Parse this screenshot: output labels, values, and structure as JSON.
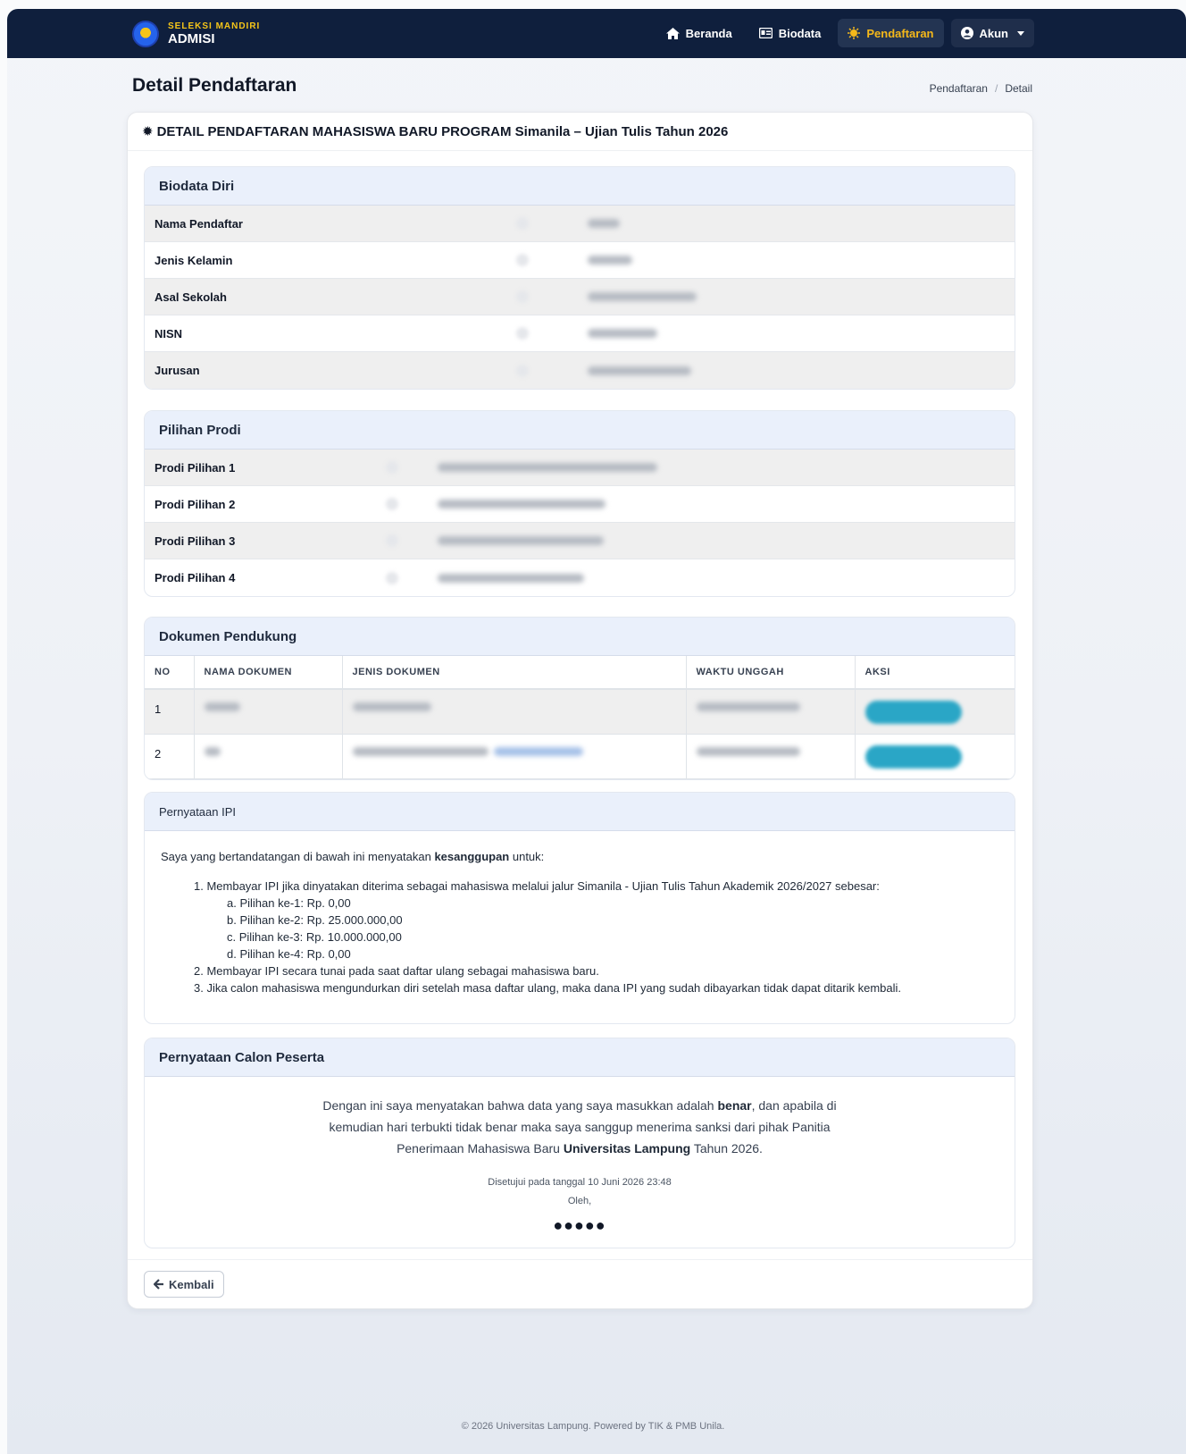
{
  "navbar": {
    "brand_small": "SELEKSI MANDIRI",
    "brand_big": "ADMISI",
    "items": [
      {
        "label": "Beranda",
        "icon": "home-icon"
      },
      {
        "label": "Biodata",
        "icon": "id-card-icon"
      },
      {
        "label": "Pendaftaran",
        "icon": "sun-burst-icon",
        "active": true
      },
      {
        "label": "Akun",
        "icon": "user-circle-icon"
      }
    ]
  },
  "page": {
    "title": "Detail Pendaftaran",
    "breadcrumb": [
      "Pendaftaran",
      "Detail"
    ],
    "breadcrumb_sep": "/"
  },
  "main_card": {
    "heading": "DETAIL PENDAFTARAN MAHASISWA BARU PROGRAM Simanila – Ujian Tulis Tahun 2026",
    "back_label": "Kembali"
  },
  "biodata": {
    "title": "Biodata Diri",
    "rows": [
      "Nama Pendaftar",
      "Jenis Kelamin",
      "Asal Sekolah",
      "NISN",
      "Jurusan"
    ]
  },
  "prodi": {
    "title": "Pilihan Prodi",
    "rows": [
      "Prodi Pilihan 1",
      "Prodi Pilihan 2",
      "Prodi Pilihan 3",
      "Prodi Pilihan 4"
    ]
  },
  "dokumen": {
    "title": "Dokumen Pendukung",
    "columns": [
      "NO",
      "NAMA DOKUMEN",
      "JENIS DOKUMEN",
      "WAKTU UNGGAH",
      "AKSI"
    ],
    "rows": [
      {
        "no": "1"
      },
      {
        "no": "2"
      }
    ]
  },
  "ipi": {
    "title": "Pernyataan IPI",
    "intro_pre": "Saya yang bertandatangan di bawah ini menyatakan ",
    "intro_bold": "kesanggupan",
    "intro_post": " untuk:",
    "item1": "1. Membayar IPI jika dinyatakan diterima sebagai mahasiswa melalui jalur Simanila - Ujian Tulis Tahun Akademik 2026/2027 sebesar:",
    "sub": [
      "a. Pilihan ke-1: Rp. 0,00",
      "b. Pilihan ke-2: Rp. 25.000.000,00",
      "c. Pilihan ke-3: Rp. 10.000.000,00",
      "d. Pilihan ke-4: Rp. 0,00"
    ],
    "item2": "2. Membayar IPI secara tunai pada saat daftar ulang sebagai mahasiswa baru.",
    "item3": "3. Jika calon mahasiswa mengundurkan diri setelah masa daftar ulang, maka dana IPI yang sudah dibayarkan tidak dapat ditarik kembali."
  },
  "pernyataan": {
    "title": "Pernyataan Calon Peserta",
    "t1": "Dengan ini saya menyatakan bahwa data yang saya masukkan adalah ",
    "b1": "benar",
    "t2": ", dan apabila di kemudian hari terbukti tidak benar maka saya sanggup menerima sanksi dari pihak Panitia Penerimaan Mahasiswa Baru ",
    "b2": "Universitas Lampung",
    "t3": " Tahun 2026.",
    "approved": "Disetujui pada tanggal 10 Juni 2026 23:48",
    "by": "Oleh,",
    "signature": "●●●●●"
  },
  "footer": "© 2026 Universitas Lampung. Powered by TIK & PMB Unila.",
  "colors": {
    "navbar": "#0f1f3d",
    "accent": "#f5b81a",
    "section_header": "#eaf0fb",
    "action_button": "#2aa6c6"
  }
}
